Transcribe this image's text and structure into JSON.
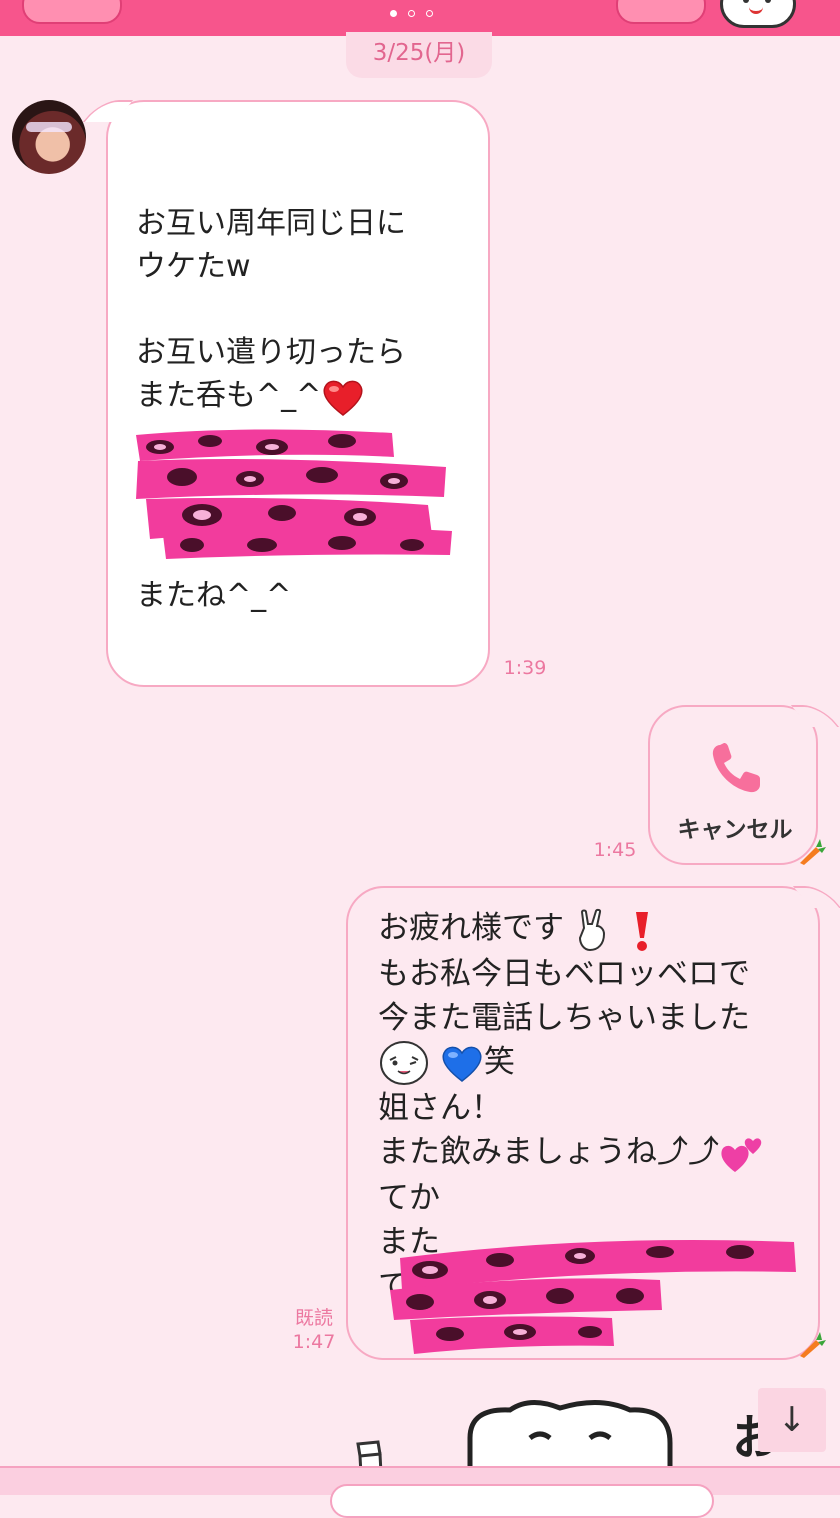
{
  "header": {
    "pages": 3,
    "active_page": 0
  },
  "date_separator": "3/25(月)",
  "messages": [
    {
      "side": "left",
      "lines": [
        "お互い周年同じ日に",
        "ウケたw",
        "",
        "お互い遣り切ったら",
        "また呑も^_^"
      ],
      "closing": "またね^_^",
      "time": "1:39",
      "emoji": "red-heart"
    },
    {
      "side": "right",
      "type": "call",
      "call_label": "キャンセル",
      "time": "1:45"
    },
    {
      "side": "right",
      "line1": "お疲れ様です",
      "line2": "もお私今日もベロッベロで",
      "line3": "今また電話しちゃいました",
      "line4_suffix": "笑",
      "line5": "姐さん！",
      "line6": "また飲みましょうね⤴⤴",
      "line7": "てか",
      "line8": "また",
      "line9": "て",
      "read_label": "既読",
      "time": "1:47"
    }
  ],
  "scroll_button": "↓",
  "sticker_text": "お",
  "colors": {
    "accent": "#f7558c",
    "bubble_border": "#f7a9c3",
    "time": "#ec78a0",
    "background": "#fde9f0"
  }
}
